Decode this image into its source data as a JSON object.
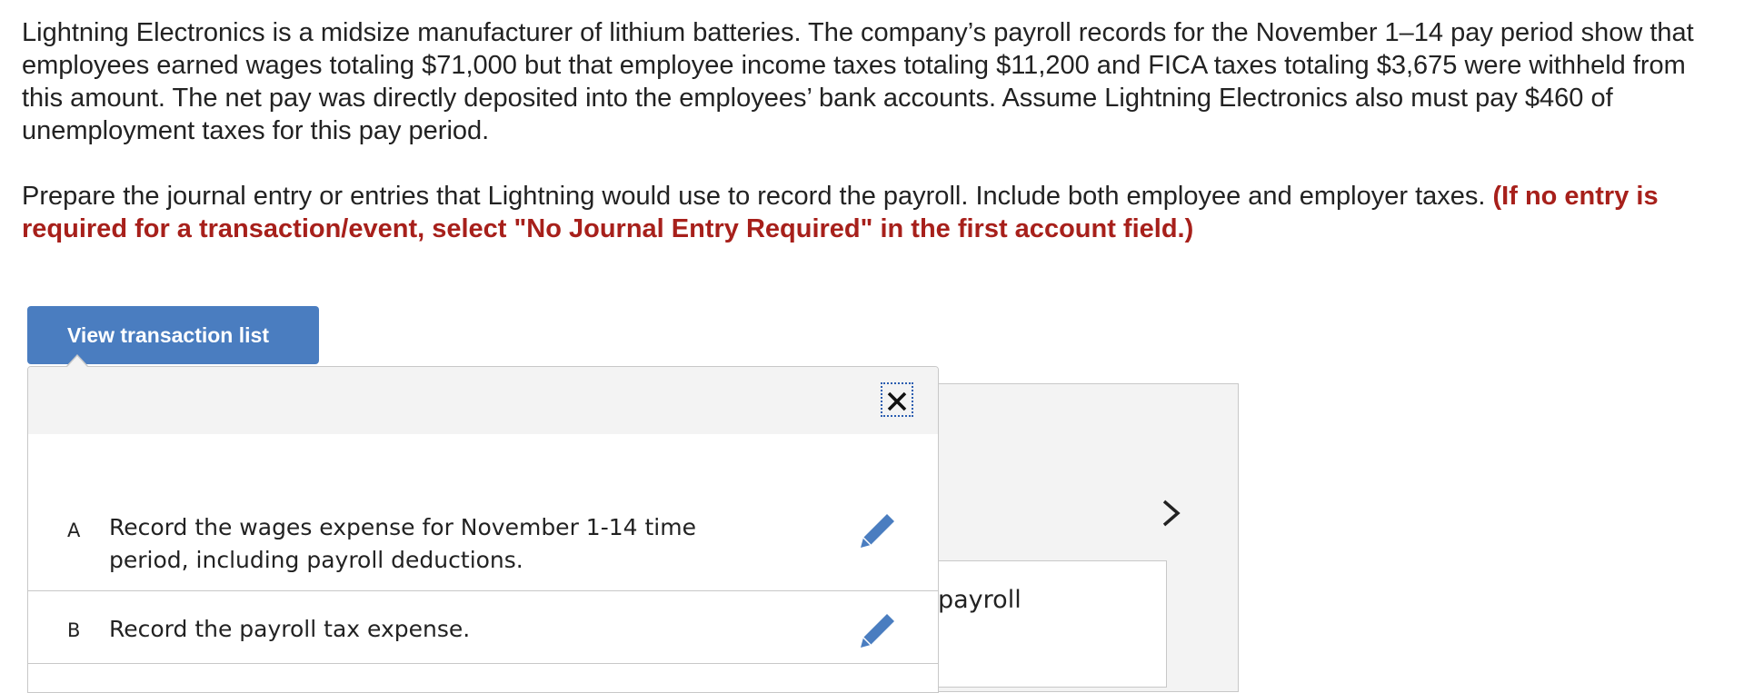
{
  "problem": {
    "paragraph1": "Lightning Electronics is a midsize manufacturer of lithium batteries. The company’s payroll records for the November 1–14 pay period show that employees earned wages totaling $71,000 but that employee income taxes totaling $11,200 and FICA taxes totaling $3,675 were withheld from this amount. The net pay was directly deposited into the employees’ bank accounts. Assume Lightning Electronics also must pay $460 of unemployment taxes for this pay period.",
    "instruction_plain": "Prepare the journal entry or entries that Lightning would use to record the payroll. Include both employee and employer taxes.",
    "instruction_emphasis": "(If no entry is required for a transaction/event, select \"No Journal Entry Required\" in the first account field.)"
  },
  "toolbar": {
    "view_transactions_label": "View transaction list"
  },
  "background_card": {
    "partial_text": "payroll"
  },
  "transaction_list": {
    "close_icon": "close-icon",
    "edit_icon": "pencil-icon",
    "items": [
      {
        "letter": "A",
        "description": "Record the wages expense for November 1-14 time period, including payroll deductions."
      },
      {
        "letter": "B",
        "description": "Record the payroll tax expense."
      }
    ]
  },
  "colors": {
    "accent": "#4a7dc0",
    "emphasis": "#a7201b",
    "panel_bg": "#f3f3f3",
    "border": "#c8c8c8"
  }
}
